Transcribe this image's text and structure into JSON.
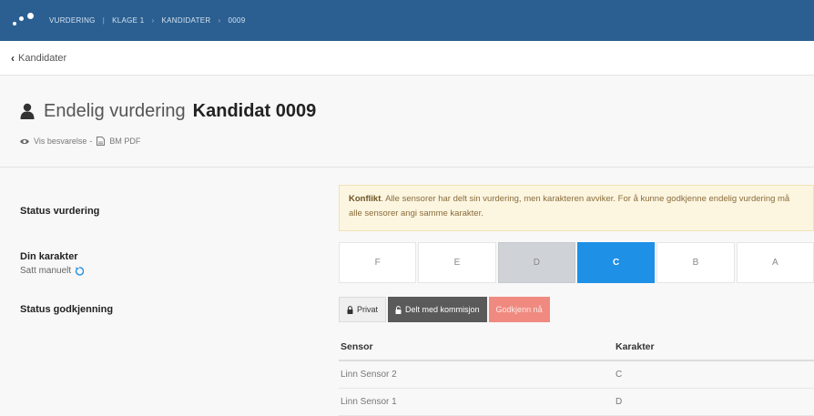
{
  "header": {
    "breadcrumb": [
      "VURDERING",
      "KLAGE 1",
      "KANDIDATER",
      "0009"
    ],
    "separators": [
      "|",
      "›",
      "›"
    ],
    "brand_color": "#2b5f91"
  },
  "back": {
    "label": "Kandidater"
  },
  "title": {
    "prefix": "Endelig vurdering",
    "candidate": "Kandidat 0009"
  },
  "links": {
    "view": "Vis besvarelse",
    "separator": "-",
    "pdf": "BM PDF"
  },
  "status_vurdering": {
    "label": "Status vurdering",
    "alert_title": "Konflikt",
    "alert_text": ". Alle sensorer har delt sin vurdering, men karakteren avviker. For å kunne godkjenne endelig vurdering må alle sensorer angi samme karakter."
  },
  "din_karakter": {
    "label": "Din karakter",
    "sub": "Satt manuelt",
    "grades": [
      "F",
      "E",
      "D",
      "C",
      "B",
      "A"
    ],
    "selected": "C",
    "disabled": "D",
    "accent": "#1e90e6"
  },
  "status_godkjenning": {
    "label": "Status godkjenning",
    "private": "Privat",
    "shared": "Delt med kommisjon",
    "approve": "Godkjenn nå"
  },
  "sensor_table": {
    "headers": [
      "Sensor",
      "Karakter"
    ],
    "rows": [
      [
        "Linn Sensor 2",
        "C"
      ],
      [
        "Linn Sensor 1",
        "D"
      ]
    ]
  }
}
